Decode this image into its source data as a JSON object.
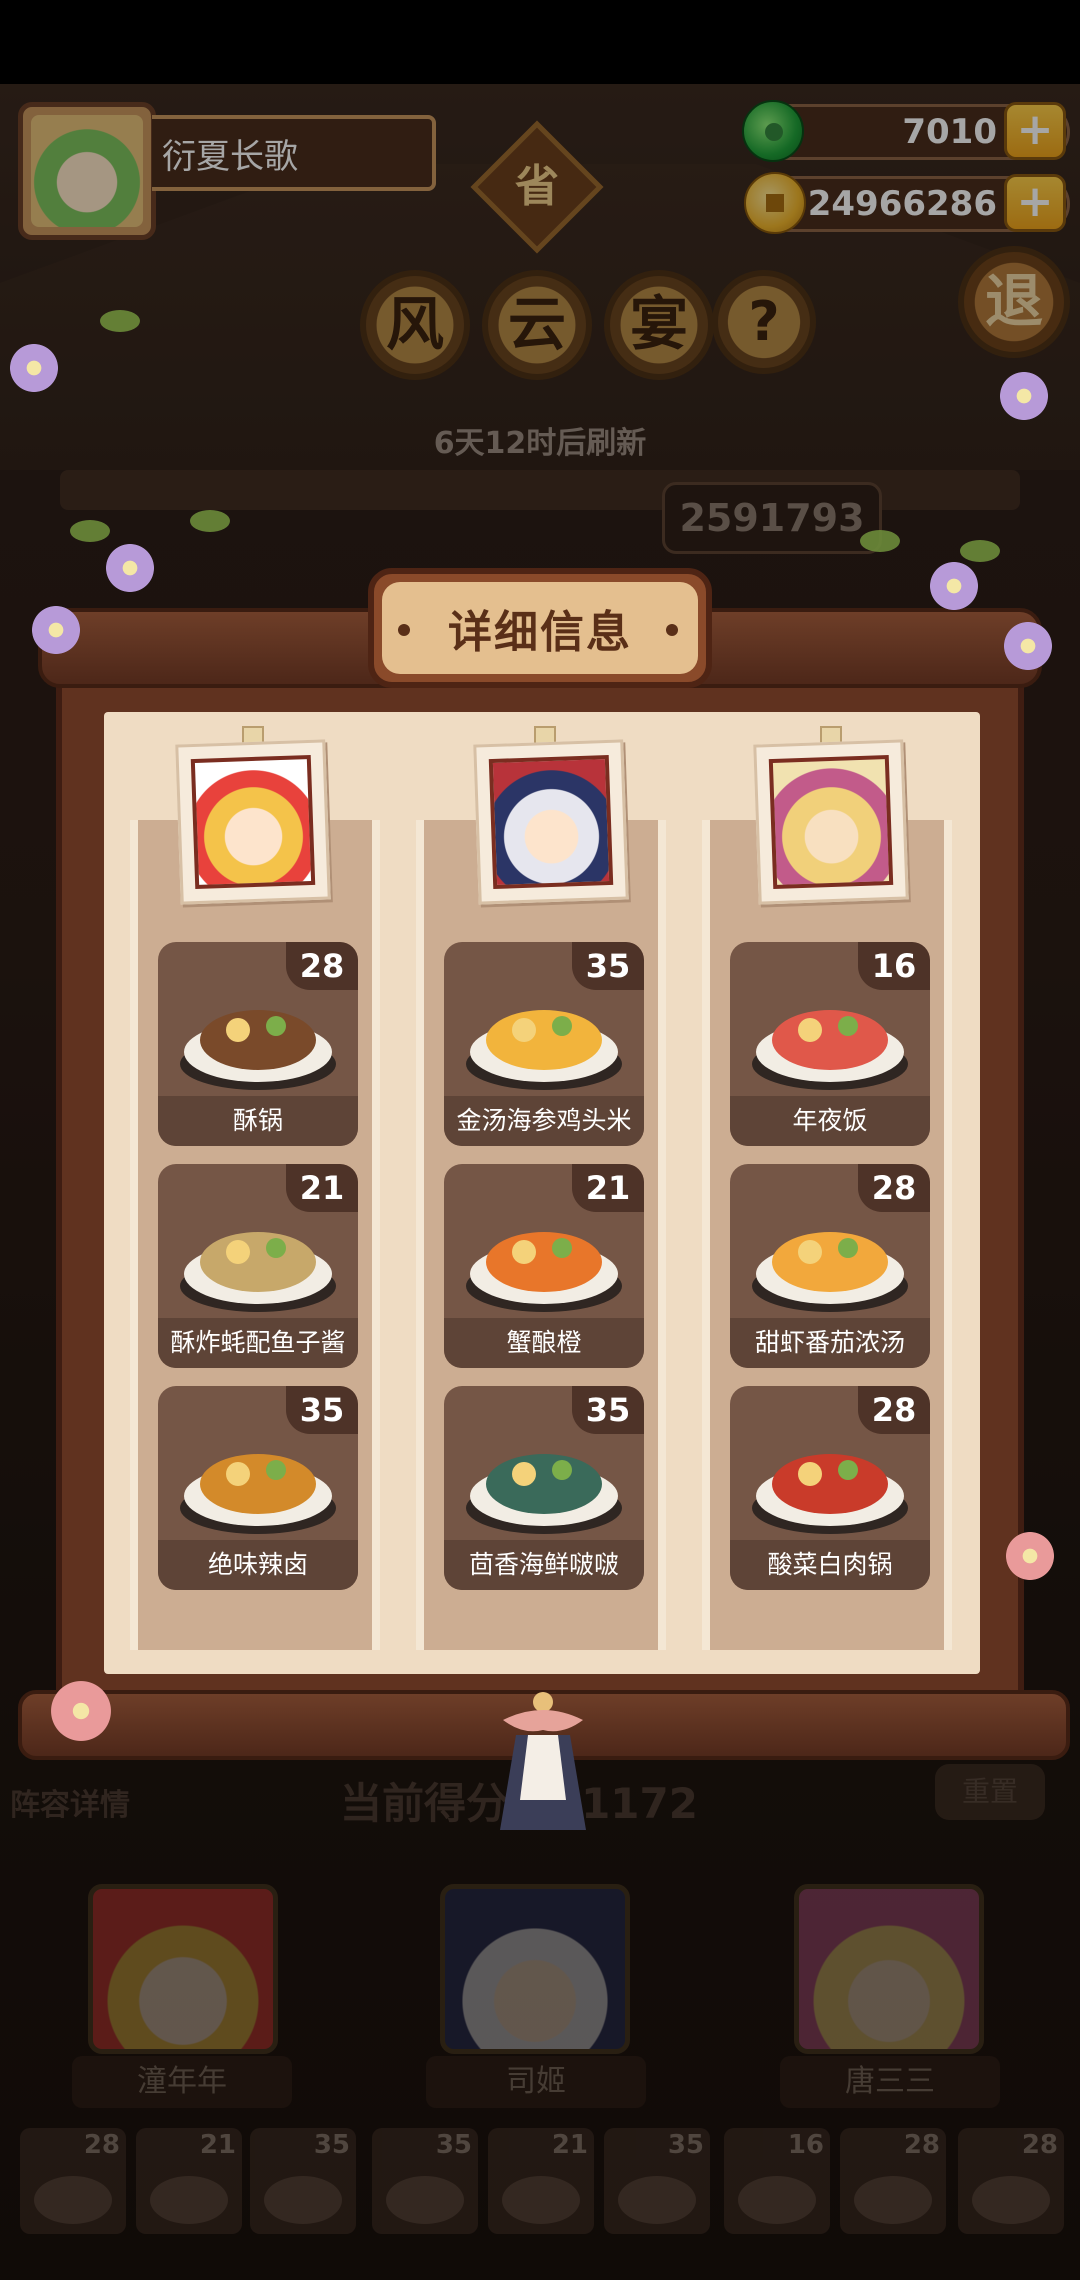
{
  "player": {
    "name": "衍夏长歌"
  },
  "resources": {
    "jade": "7010",
    "coins": "24966286",
    "plus": "+"
  },
  "event": {
    "badge": "省",
    "title_chars": [
      "风",
      "云",
      "宴"
    ],
    "help": "?",
    "exit": "退",
    "refresh": "6天12时后刷新",
    "score_behind": "2591793"
  },
  "panel": {
    "title": "详细信息",
    "columns": [
      {
        "dishes": [
          {
            "name": "酥锅",
            "count": "28",
            "color": "#7a4a2a"
          },
          {
            "name": "酥炸蚝配鱼子酱",
            "count": "21",
            "color": "#c7a86a"
          },
          {
            "name": "绝味辣卤",
            "count": "35",
            "color": "#d38a2a"
          }
        ]
      },
      {
        "dishes": [
          {
            "name": "金汤海参鸡头米",
            "count": "35",
            "color": "#f2b43c"
          },
          {
            "name": "蟹酿橙",
            "count": "21",
            "color": "#e8762a"
          },
          {
            "name": "茴香海鲜啵啵",
            "count": "35",
            "color": "#3a6a5a"
          }
        ]
      },
      {
        "dishes": [
          {
            "name": "年夜饭",
            "count": "16",
            "color": "#e0584a"
          },
          {
            "name": "甜虾番茄浓汤",
            "count": "28",
            "color": "#f2a83c"
          },
          {
            "name": "酸菜白肉锅",
            "count": "28",
            "color": "#c93b2a"
          }
        ]
      }
    ]
  },
  "team": {
    "label": "阵容详情",
    "score": "当前得分 261172",
    "button": "重置",
    "heroes": [
      {
        "name": "潼年年"
      },
      {
        "name": "司姬"
      },
      {
        "name": "唐三三"
      }
    ],
    "mini_counts": [
      "28",
      "21",
      "35",
      "35",
      "21",
      "35",
      "16",
      "28",
      "28"
    ]
  }
}
